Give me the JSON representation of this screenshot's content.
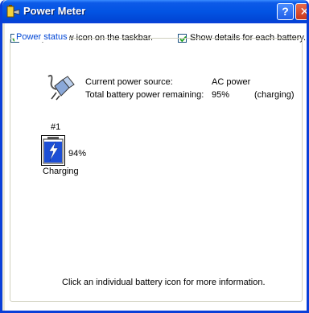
{
  "window": {
    "title": "Power Meter",
    "help_label": "?",
    "close_label": "✕"
  },
  "options": {
    "always_show_icon": {
      "label": "Always show icon on the taskbar.",
      "checked": true
    },
    "show_details": {
      "label": "Show details for each battery.",
      "checked": true
    }
  },
  "power_status": {
    "group_label": "Power status",
    "source_label": "Current power source:",
    "source_value": "AC power",
    "remaining_label": "Total battery power remaining:",
    "remaining_value": "95%",
    "remaining_state": "(charging)"
  },
  "batteries": [
    {
      "number": "#1",
      "percent": "94%",
      "status": "Charging",
      "level": 0.94
    }
  ],
  "footer": {
    "hint": "Click an individual battery icon for more information."
  },
  "colors": {
    "titlebar": "#0254e3",
    "group_label": "#0046d5",
    "battery_fill": "#1d4fd6",
    "check": "#21a121"
  },
  "icons": {
    "title": "battery-plug-icon",
    "power_source": "plug-icon",
    "battery": "battery-charging-icon",
    "check": "checkmark-icon"
  }
}
